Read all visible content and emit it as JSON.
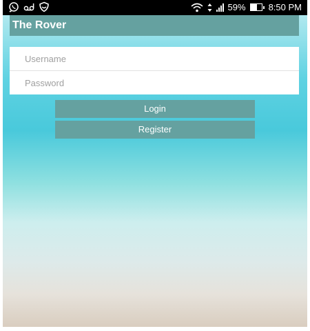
{
  "status_bar": {
    "battery_percent": "59%",
    "time": "8:50 PM",
    "left_icons": [
      "whatsapp-icon",
      "voicemail-icon",
      "shield-icon"
    ],
    "right_icons": [
      "wifi-icon",
      "data-arrows-icon",
      "signal-icon",
      "battery-icon"
    ]
  },
  "app_bar": {
    "title": "The Rover"
  },
  "form": {
    "username_placeholder": "Username",
    "password_placeholder": "Password",
    "login_label": "Login",
    "register_label": "Register"
  },
  "colors": {
    "accent": "#65a1a0",
    "status_bar": "#000000",
    "field_bg": "#ffffff"
  }
}
